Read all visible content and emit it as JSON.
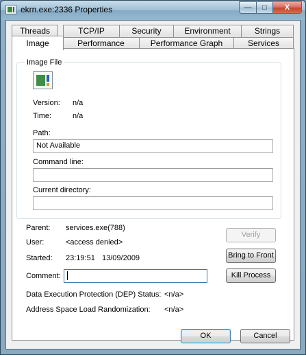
{
  "window": {
    "title": "ekrn.exe:2336 Properties",
    "minimize_glyph": "—",
    "maximize_glyph": "□",
    "close_glyph": "X"
  },
  "tabs_row1": [
    {
      "label": "Threads"
    },
    {
      "label": "TCP/IP"
    },
    {
      "label": "Security"
    },
    {
      "label": "Environment"
    },
    {
      "label": "Strings"
    }
  ],
  "tabs_row2": [
    {
      "label": "Image",
      "active": true
    },
    {
      "label": "Performance"
    },
    {
      "label": "Performance Graph"
    },
    {
      "label": "Services"
    }
  ],
  "image_file": {
    "group_title": "Image File",
    "icon": "app-icon",
    "version_label": "Version:",
    "version_value": "n/a",
    "time_label": "Time:",
    "time_value": "n/a",
    "path_label": "Path:",
    "path_value": "Not Available",
    "command_line_label": "Command line:",
    "command_line_value": "",
    "current_directory_label": "Current directory:",
    "current_directory_value": ""
  },
  "process": {
    "parent_label": "Parent:",
    "parent_value": "services.exe(788)",
    "user_label": "User:",
    "user_value": "<access denied>",
    "started_label": "Started:",
    "started_time": "23:19:51",
    "started_date": "13/09/2009",
    "comment_label": "Comment:",
    "comment_value": "",
    "dep_label": "Data Execution Protection (DEP) Status:",
    "dep_value": "<n/a>",
    "aslr_label": "Address Space Load Randomization:",
    "aslr_value": "<n/a>"
  },
  "buttons": {
    "verify": "Verify",
    "bring_to_front": "Bring to Front",
    "kill_process": "Kill Process",
    "ok": "OK",
    "cancel": "Cancel"
  }
}
